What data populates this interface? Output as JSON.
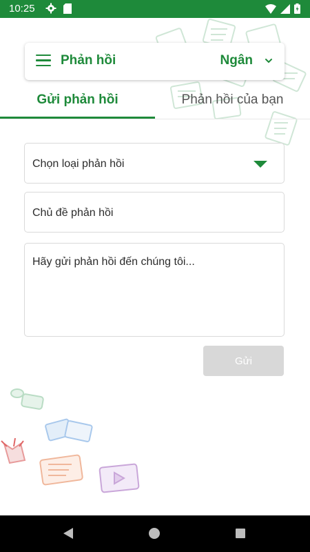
{
  "status_bar": {
    "time": "10:25"
  },
  "header": {
    "title": "Phản hồi",
    "user_name": "Ngân"
  },
  "tabs": [
    {
      "label": "Gửi phản hồi",
      "active": true
    },
    {
      "label": "Phản hồi của bạn",
      "active": false
    }
  ],
  "form": {
    "type_select_value": "Chọn loại phản hồi",
    "subject_placeholder": "Chủ đề phản hồi",
    "message_placeholder": "Hãy gửi phản hồi đến chúng tôi...",
    "send_label": "Gửi"
  },
  "colors": {
    "primary": "#1e8a3a",
    "disabled_button": "#d8d8d8"
  }
}
